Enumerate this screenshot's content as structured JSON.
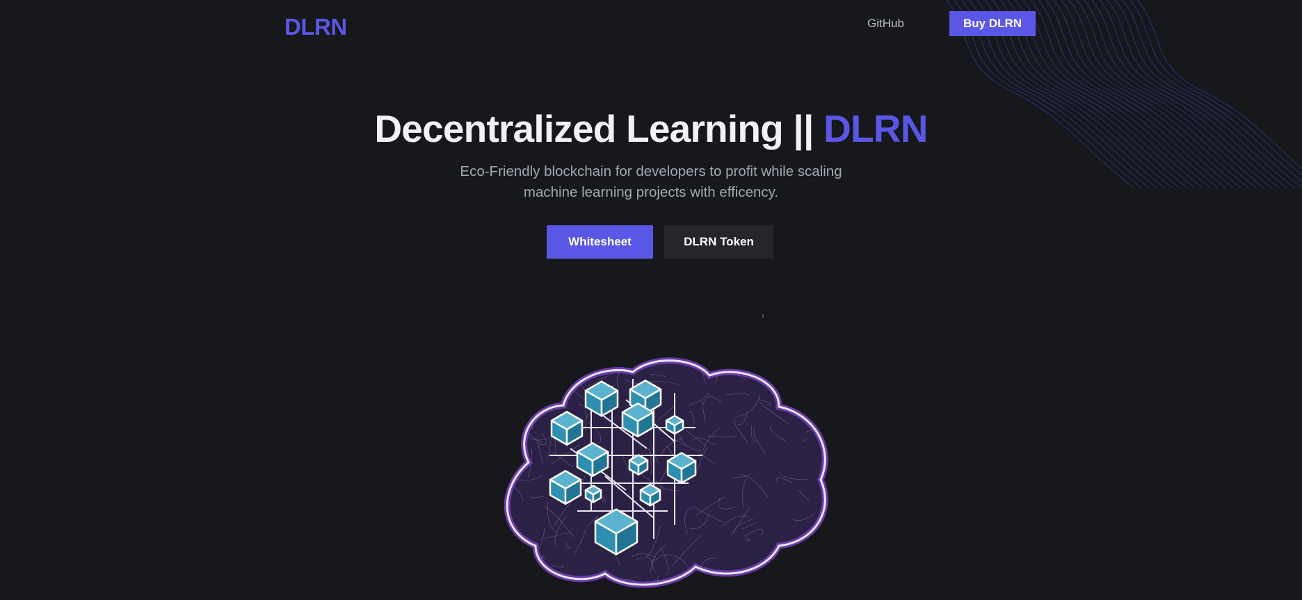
{
  "nav": {
    "logo": "DLRN",
    "github_label": "GitHub",
    "buy_label": "Buy DLRN"
  },
  "hero": {
    "title_main": "Decentralized Learning || ",
    "title_accent": "DLRN",
    "subtitle": "Eco-Friendly blockchain for developers to profit while scaling machine learning projects with efficency.",
    "primary_button": "Whitesheet",
    "secondary_button": "DLRN Token"
  },
  "colors": {
    "accent": "#5a57e6",
    "background": "#17181b",
    "secondary_button_bg": "#24262b",
    "cube": "#2e8fb0",
    "brain_fill": "#2b2145",
    "brain_outline": "#6a3aa8"
  },
  "icons": {
    "background_decoration": "wave-lines-graphic",
    "hero_image": "brain-with-cubes-illustration"
  }
}
